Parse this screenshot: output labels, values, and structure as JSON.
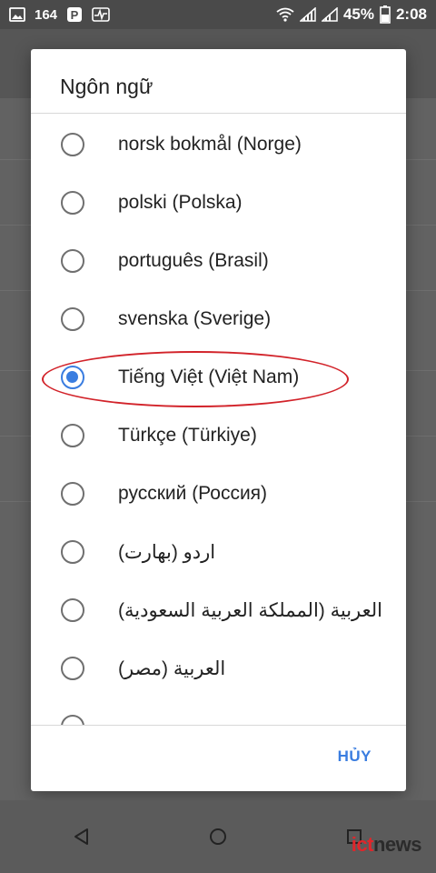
{
  "status_bar": {
    "notif_count": "164",
    "battery": "45%",
    "time": "2:08"
  },
  "dialog": {
    "title": "Ngôn ngữ",
    "cancel_label": "HỦY",
    "options": [
      {
        "label": "norsk bokmål (Norge)",
        "selected": false
      },
      {
        "label": "polski (Polska)",
        "selected": false
      },
      {
        "label": "português (Brasil)",
        "selected": false
      },
      {
        "label": "svenska (Sverige)",
        "selected": false
      },
      {
        "label": "Tiếng Việt (Việt Nam)",
        "selected": true
      },
      {
        "label": "Türkçe (Türkiye)",
        "selected": false
      },
      {
        "label": "русский (Россия)",
        "selected": false
      },
      {
        "label": "اردو (بھارت)",
        "selected": false
      },
      {
        "label": "العربية (المملكة العربية السعودية)",
        "selected": false
      },
      {
        "label": "العربية (مصر)",
        "selected": false
      },
      {
        "label": "",
        "selected": false
      }
    ]
  },
  "watermark": {
    "prefix": "ict",
    "suffix": "news"
  },
  "colors": {
    "accent": "#3a7de0",
    "highlight": "#d2232a"
  }
}
